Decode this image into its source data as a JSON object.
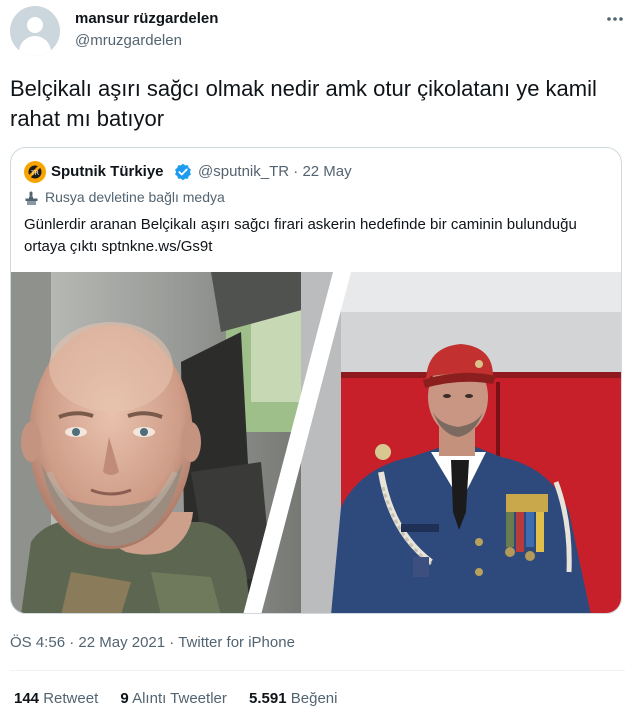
{
  "author": {
    "display_name": "mansur rüzgardelen",
    "handle": "@mruzgardelen"
  },
  "more_icon": "more-horizontal-icon",
  "tweet": {
    "text": "Belçikalı aşırı sağcı olmak nedir amk otur çikolatanı ye kamil rahat mı batıyor"
  },
  "quoted_tweet": {
    "display_name": "Sputnik Türkiye",
    "verified": true,
    "handle": "@sputnik_TR",
    "separator": "·",
    "date": "22 May",
    "label": "Rusya devletine bağlı medya",
    "text": "Günlerdir aranan Belçikalı aşırı sağcı firari askerin hedefinde bir caminin bulunduğu ortaya çıktı sptnkne.ws/Gs9t",
    "colors": {
      "brand": "#f7a300",
      "verified": "#1d9bf0"
    }
  },
  "meta": {
    "time": "ÖS 4:56",
    "separator": "·",
    "date": "22 May 2021",
    "separator2": "·",
    "source": "Twitter for iPhone"
  },
  "stats": [
    {
      "count": "144",
      "label": "Retweet"
    },
    {
      "count": "9",
      "label": "Alıntı Tweetler"
    },
    {
      "count": "5.591",
      "label": "Beğeni"
    }
  ]
}
